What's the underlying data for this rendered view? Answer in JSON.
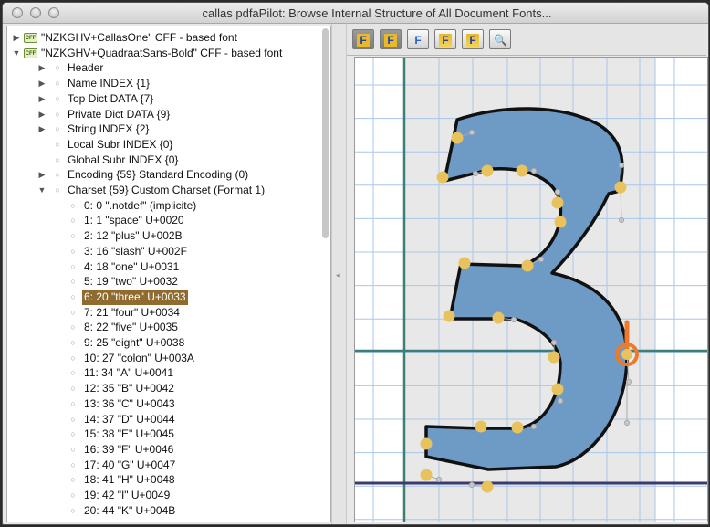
{
  "window": {
    "title": "callas pdfaPilot: Browse Internal Structure of All Document Fonts..."
  },
  "tree": {
    "rows": [
      {
        "label": "\"NZKGHV+CallasOne\"  CFF - based font",
        "badge": "CFF",
        "toggle": "collapsed",
        "level": 0
      },
      {
        "label": "\"NZKGHV+QuadraatSans-Bold\"  CFF - based font",
        "badge": "CFF",
        "toggle": "expanded",
        "level": 0
      },
      {
        "label": "Header",
        "toggle": "collapsed",
        "level": 1
      },
      {
        "label": "Name INDEX {1}",
        "toggle": "collapsed",
        "level": 1
      },
      {
        "label": "Top Dict DATA {7}",
        "toggle": "collapsed",
        "level": 1
      },
      {
        "label": "Private Dict DATA {9}",
        "toggle": "collapsed",
        "level": 1
      },
      {
        "label": "String INDEX {2}",
        "toggle": "collapsed",
        "level": 1
      },
      {
        "label": "Local Subr INDEX {0}",
        "toggle": "none",
        "level": 1
      },
      {
        "label": "Global Subr INDEX {0}",
        "toggle": "none",
        "level": 1
      },
      {
        "label": "Encoding {59} Standard Encoding (0)",
        "toggle": "collapsed",
        "level": 1
      },
      {
        "label": "Charset {59} Custom Charset (Format 1)",
        "toggle": "expanded",
        "level": 1
      },
      {
        "label": "0: 0 \".notdef\"  (implicite)",
        "toggle": "none",
        "level": 2
      },
      {
        "label": "1: 1 \"space\" U+0020",
        "toggle": "none",
        "level": 2
      },
      {
        "label": "2: 12 \"plus\" U+002B",
        "toggle": "none",
        "level": 2
      },
      {
        "label": "3: 16 \"slash\" U+002F",
        "toggle": "none",
        "level": 2
      },
      {
        "label": "4: 18 \"one\" U+0031",
        "toggle": "none",
        "level": 2
      },
      {
        "label": "5: 19 \"two\" U+0032",
        "toggle": "none",
        "level": 2
      },
      {
        "label": "6: 20 \"three\" U+0033",
        "toggle": "none",
        "level": 2,
        "selected": true
      },
      {
        "label": "7: 21 \"four\" U+0034",
        "toggle": "none",
        "level": 2
      },
      {
        "label": "8: 22 \"five\" U+0035",
        "toggle": "none",
        "level": 2
      },
      {
        "label": "9: 25 \"eight\" U+0038",
        "toggle": "none",
        "level": 2
      },
      {
        "label": "10: 27 \"colon\" U+003A",
        "toggle": "none",
        "level": 2
      },
      {
        "label": "11: 34 \"A\" U+0041",
        "toggle": "none",
        "level": 2
      },
      {
        "label": "12: 35 \"B\" U+0042",
        "toggle": "none",
        "level": 2
      },
      {
        "label": "13: 36 \"C\" U+0043",
        "toggle": "none",
        "level": 2
      },
      {
        "label": "14: 37 \"D\" U+0044",
        "toggle": "none",
        "level": 2
      },
      {
        "label": "15: 38 \"E\" U+0045",
        "toggle": "none",
        "level": 2
      },
      {
        "label": "16: 39 \"F\" U+0046",
        "toggle": "none",
        "level": 2
      },
      {
        "label": "17: 40 \"G\" U+0047",
        "toggle": "none",
        "level": 2
      },
      {
        "label": "18: 41 \"H\" U+0048",
        "toggle": "none",
        "level": 2
      },
      {
        "label": "19: 42 \"I\" U+0049",
        "toggle": "none",
        "level": 2
      },
      {
        "label": "20: 44 \"K\" U+004B",
        "toggle": "none",
        "level": 2
      }
    ]
  },
  "toolbar": {
    "buttons": [
      {
        "name": "show-points-button",
        "icon": "grid-points-icon",
        "glyph": "F",
        "pressed": true
      },
      {
        "name": "show-outline-button",
        "icon": "outline-f-icon",
        "glyph": "F",
        "pressed": true
      },
      {
        "name": "show-filled-button",
        "icon": "filled-f-icon",
        "glyph": "F",
        "pressed": false
      },
      {
        "name": "show-hints-button",
        "icon": "hints-f-icon",
        "glyph": "F",
        "pressed": false
      },
      {
        "name": "show-metrics-button",
        "icon": "metrics-f-icon",
        "glyph": "F",
        "pressed": false
      },
      {
        "name": "zoom-button",
        "icon": "magnifier-icon",
        "glyph": "",
        "pressed": false
      }
    ]
  },
  "glyph_view": {
    "glyph_name": "three",
    "fill_color": "#6e9bc5",
    "point_color": "#e8c25c",
    "guide_color": "#3d7f76",
    "baseline_color": "#3c3a70",
    "marker_color": "#ec7a2c"
  }
}
